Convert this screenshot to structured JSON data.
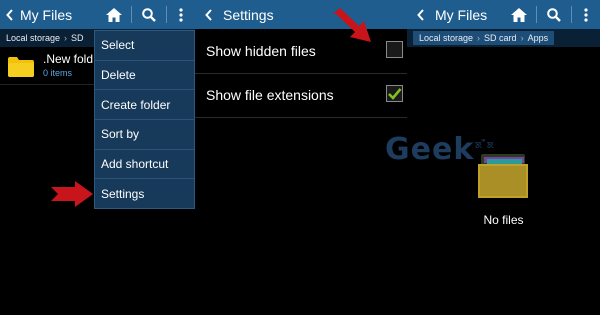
{
  "panel1": {
    "title": "My Files",
    "breadcrumb": [
      "Local storage",
      "SD"
    ],
    "file": {
      "name": ".New fold",
      "sub": "0 items"
    },
    "menu": [
      "Select",
      "Delete",
      "Create folder",
      "Sort by",
      "Add shortcut",
      "Settings"
    ]
  },
  "panel2": {
    "title": "Settings",
    "settings": [
      {
        "label": "Show hidden files",
        "checked": false
      },
      {
        "label": "Show file extensions",
        "checked": true
      }
    ]
  },
  "panel3": {
    "title": "My Files",
    "breadcrumb": [
      "Local storage",
      "SD card",
      "Apps"
    ],
    "empty_text": "No files"
  },
  "watermark": {
    "text": "Geek",
    "small": "ꯗ ꯩ ꯗ"
  },
  "icons": [
    "back-chevron-icon",
    "home-icon",
    "search-icon",
    "more-vert-icon",
    "folder-icon",
    "checkbox-icon",
    "checkmark-icon",
    "red-arrow-icon"
  ],
  "colors": {
    "action_bar": "#1f5d8f",
    "menu_bg": "#173a5a",
    "breadcrumb_bg": "#0a2035",
    "arrow": "#c8151b",
    "check": "#7fc31c",
    "folder": "#f2c10a"
  }
}
